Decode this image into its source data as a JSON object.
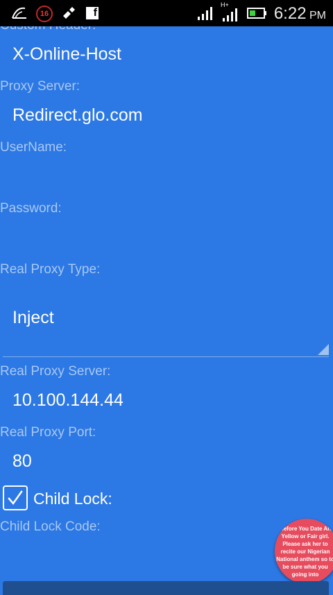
{
  "status_bar": {
    "notification_count": "16",
    "network_type": "H+",
    "time": "6:22",
    "ampm": "PM",
    "icons": [
      "signal-wave-icon",
      "notification-badge-icon",
      "brush-icon",
      "facebook-icon",
      "signal-bars-icon",
      "signal-bars-hplus-icon",
      "battery-icon"
    ]
  },
  "form": {
    "custom_header_label": "Custom Header:",
    "custom_header_value": "X-Online-Host",
    "proxy_server_label": "Proxy Server:",
    "proxy_server_value": "Redirect.glo.com",
    "username_label": "UserName:",
    "username_value": "",
    "password_label": "Password:",
    "password_value": "",
    "real_proxy_type_label": "Real Proxy Type:",
    "real_proxy_type_value": "Inject",
    "real_proxy_server_label": "Real Proxy Server:",
    "real_proxy_server_value": "10.100.144.44",
    "real_proxy_port_label": "Real Proxy Port:",
    "real_proxy_port_value": "80",
    "child_lock_label": "Child Lock:",
    "child_lock_checked": true,
    "child_lock_code_label": "Child Lock Code:",
    "child_lock_code_value": ""
  },
  "ad": {
    "text": "Before You Date An Yellow or Fair girl. Please ask her to recite our Nigerian National anthem so to be sure what you going into"
  },
  "colors": {
    "background": "#2c78e4",
    "status_bar": "#000000",
    "label": "#a9c8f3",
    "value": "#ffffff",
    "ad_bubble": "#e74b5e",
    "bottom_button": "#1f4f8f"
  }
}
